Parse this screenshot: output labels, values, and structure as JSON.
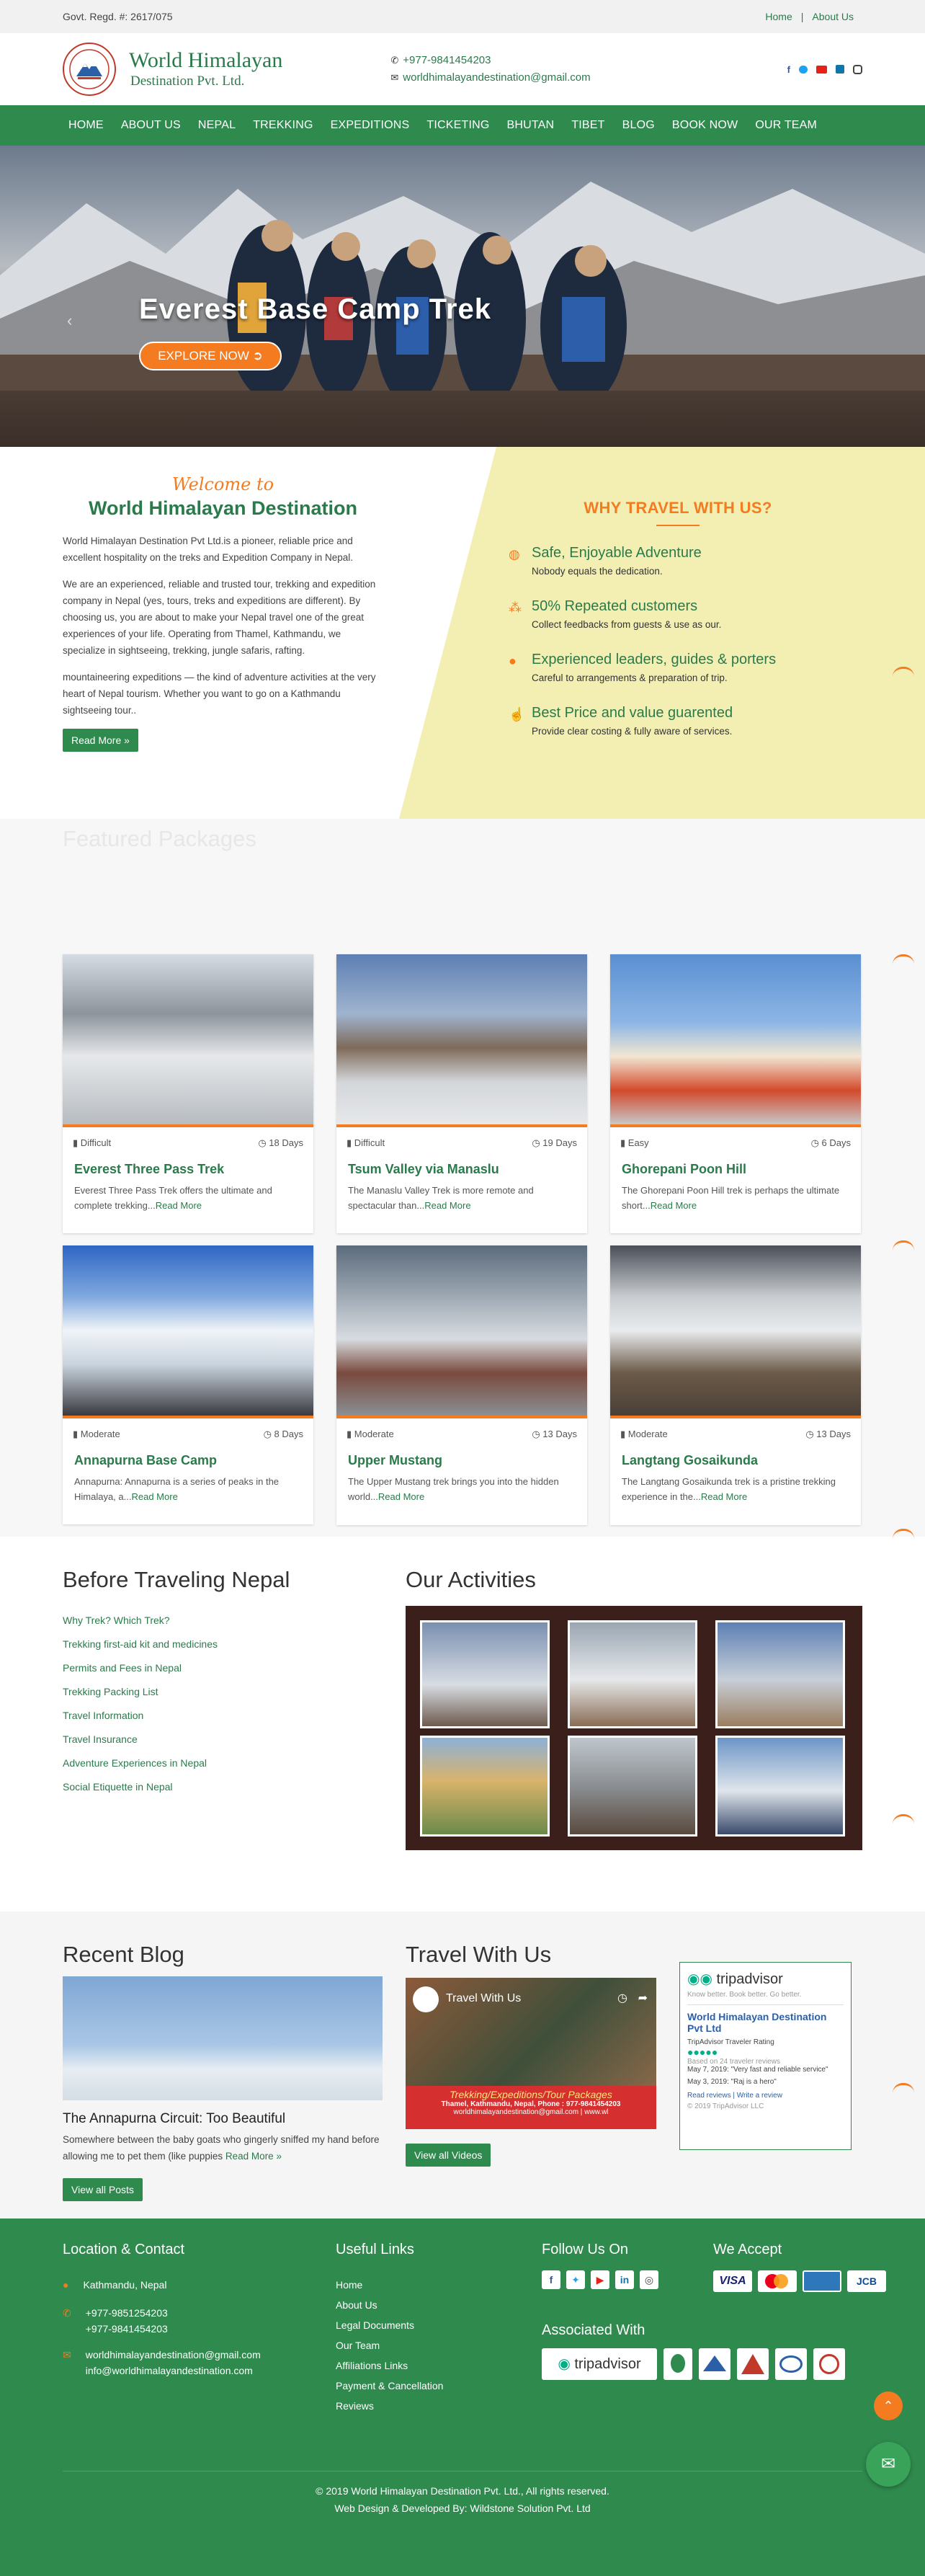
{
  "topbar": {
    "regd": "Govt. Regd. #: 2617/075",
    "links": [
      "Home",
      "About Us"
    ]
  },
  "header": {
    "name1": "World Himalayan",
    "name2": "Destination Pvt. Ltd.",
    "phone": "+977-9841454203",
    "email": "worldhimalayandestination@gmail.com"
  },
  "nav": [
    "HOME",
    "ABOUT US",
    "NEPAL",
    "TREKKING",
    "EXPEDITIONS",
    "TICKETING",
    "BHUTAN",
    "TIBET",
    "BLOG",
    "BOOK NOW",
    "OUR TEAM"
  ],
  "hero": {
    "title": "Everest Base Camp Trek",
    "cta": "EXPLORE NOW"
  },
  "welcome": {
    "script": "Welcome to",
    "title": "World Himalayan Destination",
    "p1": "World Himalayan Destination Pvt Ltd.is a pioneer, reliable price and excellent hospitality on the treks and Expedition Company in Nepal.",
    "p2": "We are an experienced, reliable and trusted tour, trekking and expedition company in Nepal (yes, tours, treks and expeditions are different). By choosing us, you are about to make your Nepal travel one of the great experiences of your life. Operating from Thamel, Kathmandu, we specialize in sightseeing, trekking, jungle safaris, rafting.",
    "p3": "mountaineering expeditions — the kind of adventure activities at the very heart of Nepal tourism. Whether you want to go on a Kathmandu sightseeing tour..",
    "btn": "Read More"
  },
  "why": {
    "title": "WHY TRAVEL WITH US?",
    "items": [
      {
        "t": "Safe, Enjoyable Adventure",
        "d": "Nobody equals the dedication."
      },
      {
        "t": "50% Repeated customers",
        "d": "Collect feedbacks from guests & use as our."
      },
      {
        "t": "Experienced leaders, guides & porters",
        "d": "Careful to arrangements & preparation of trip."
      },
      {
        "t": "Best Price and value guarented",
        "d": "Provide clear costing & fully aware of services."
      }
    ]
  },
  "featured": {
    "title": "Featured Packages",
    "cards": [
      {
        "diff": "Difficult",
        "days": "18 Days",
        "title": "Everest Three Pass Trek",
        "desc": "Everest Three Pass Trek offers the ultimate and complete trekking...",
        "more": "Read More"
      },
      {
        "diff": "Difficult",
        "days": "19 Days",
        "title": "Tsum Valley via Manaslu",
        "desc": "The Manaslu Valley Trek is more remote and spectacular than...",
        "more": "Read More"
      },
      {
        "diff": "Easy",
        "days": "6 Days",
        "title": "Ghorepani Poon Hill",
        "desc": "The Ghorepani Poon Hill trek is perhaps the ultimate short...",
        "more": "Read More"
      },
      {
        "diff": "Moderate",
        "days": "8 Days",
        "title": "Annapurna Base Camp",
        "desc": "Annapurna: Annapurna is a series of peaks in the Himalaya, a...",
        "more": "Read More"
      },
      {
        "diff": "Moderate",
        "days": "13 Days",
        "title": "Upper Mustang",
        "desc": "The Upper Mustang trek brings you into the hidden world...",
        "more": "Read More"
      },
      {
        "diff": "Moderate",
        "days": "13 Days",
        "title": "Langtang Gosaikunda",
        "desc": "The Langtang Gosaikunda trek is a pristine trekking experience in the...",
        "more": "Read More"
      }
    ]
  },
  "before": {
    "title": "Before Traveling Nepal",
    "links": [
      "Why Trek? Which Trek?",
      "Trekking first-aid kit and medicines",
      "Permits and Fees in Nepal",
      "Trekking Packing List",
      "Travel Information",
      "Travel Insurance",
      "Adventure Experiences in Nepal",
      "Social Etiquette in Nepal"
    ]
  },
  "activities": {
    "title": "Our Activities"
  },
  "blog": {
    "title": "Recent Blog",
    "post_title": "The Annapurna Circuit: Too Beautiful",
    "post_desc": "Somewhere between the baby goats who gingerly sniffed my hand before allowing me to pet them (like puppies",
    "more": "Read More",
    "btn": "View all Posts"
  },
  "travel": {
    "title": "Travel With Us",
    "video_label": "Travel With Us",
    "banner": "Trekking/Expeditions/Tour Packages",
    "banner2": "Thamel, Kathmandu, Nepal, Phone : 977-9841454203",
    "banner3": "worldhimalayandestination@gmail.com | www.wl",
    "btn": "View all Videos"
  },
  "tripadvisor": {
    "logo": "tripadvisor",
    "tagline": "Know better. Book better. Go better.",
    "name": "World Himalayan Destination Pvt Ltd",
    "rating_label": "TripAdvisor Traveler Rating",
    "based": "Based on 24 traveler reviews",
    "r1": "May 7, 2019: \"Very fast and reliable service\"",
    "r2": "May 3, 2019: \"Raj is a hero\"",
    "read": "Read reviews",
    "write": "Write a review",
    "copy": "© 2019 TripAdvisor LLC"
  },
  "footer": {
    "loc_title": "Location & Contact",
    "address": "Kathmandu, Nepal",
    "phone1": "+977-9851254203",
    "phone2": "+977-9841454203",
    "email1": "worldhimalayandestination@gmail.com",
    "email2": "info@worldhimalayandestination.com",
    "links_title": "Useful Links",
    "links": [
      "Home",
      "About Us",
      "Legal Documents",
      "Our Team",
      "Affiliations Links",
      "Payment & Cancellation",
      "Reviews"
    ],
    "follow_title": "Follow Us On",
    "accept_title": "We Accept",
    "cards": [
      "VISA",
      "MC",
      "AMEX",
      "JCB"
    ],
    "assoc_title": "Associated With",
    "copy": "© 2019 World Himalayan Destination Pvt. Ltd., All rights reserved.",
    "dev": "Web Design & Developed By: Wildstone Solution Pvt. Ltd"
  },
  "colors": {
    "green": "#2f8a4e",
    "orange": "#f47b20",
    "yellow": "#f3efb2"
  }
}
